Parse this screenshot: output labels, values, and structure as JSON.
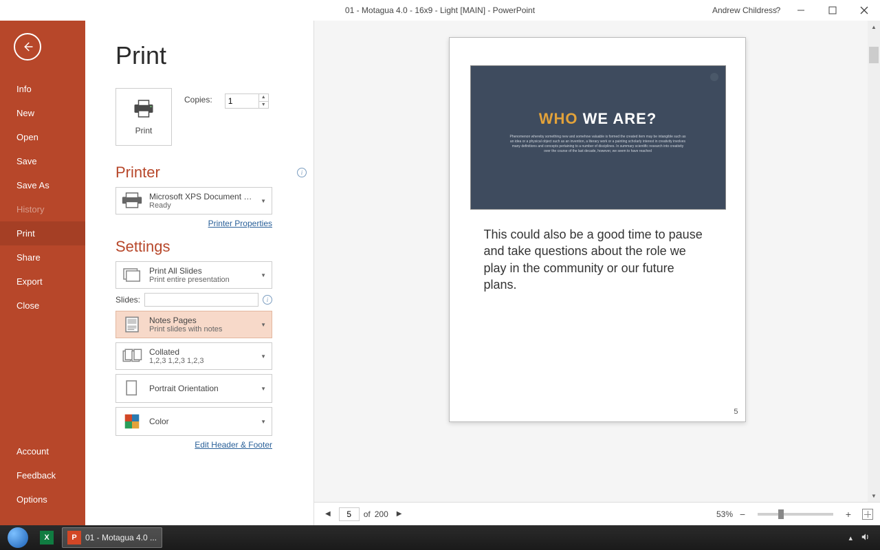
{
  "titlebar": {
    "title": "01 - Motagua 4.0 - 16x9 - Light [MAIN]  -  PowerPoint",
    "user": "Andrew Childress",
    "help": "?"
  },
  "sidebar": {
    "items": [
      {
        "label": "Info",
        "key": "info"
      },
      {
        "label": "New",
        "key": "new"
      },
      {
        "label": "Open",
        "key": "open"
      },
      {
        "label": "Save",
        "key": "save"
      },
      {
        "label": "Save As",
        "key": "saveas"
      },
      {
        "label": "History",
        "key": "history",
        "disabled": true
      },
      {
        "label": "Print",
        "key": "print",
        "selected": true
      },
      {
        "label": "Share",
        "key": "share"
      },
      {
        "label": "Export",
        "key": "export"
      },
      {
        "label": "Close",
        "key": "close"
      }
    ],
    "footer": [
      {
        "label": "Account",
        "key": "account"
      },
      {
        "label": "Feedback",
        "key": "feedback"
      },
      {
        "label": "Options",
        "key": "options"
      }
    ]
  },
  "main": {
    "title": "Print",
    "print_button": "Print",
    "copies_label": "Copies:",
    "copies_value": "1",
    "printer_heading": "Printer",
    "printer_name": "Microsoft XPS Document W...",
    "printer_status": "Ready",
    "printer_properties": "Printer Properties",
    "settings_heading": "Settings",
    "print_range_title": "Print All Slides",
    "print_range_sub": "Print entire presentation",
    "slides_label": "Slides:",
    "slides_value": "",
    "layout_title": "Notes Pages",
    "layout_sub": "Print slides with notes",
    "collate_title": "Collated",
    "collate_sub": "1,2,3    1,2,3    1,2,3",
    "orientation_title": "Portrait Orientation",
    "color_title": "Color",
    "edit_header_footer": "Edit Header & Footer"
  },
  "preview": {
    "slide_title_a": "WHO",
    "slide_title_b": " WE ARE?",
    "slide_body": "Phenomenon whereby something new and somehow valuable is formed the created item may be intangible such as an idea or a physical object such as an invention, a literary work or a painting scholarly interest in creativity involves many definitions and concepts pertaining to a number of disciplines. In summary scientific research into creativity over the course of the last decade, however, we seem to have reached",
    "notes": "This could also be a good time to pause and take questions about the role we play in the community or our future plans.",
    "page_index": "5"
  },
  "statusbar": {
    "page_current": "5",
    "page_total_prefix": " of ",
    "page_total": "200",
    "zoom": "53%"
  },
  "taskbar": {
    "app1": "01 - Motagua 4.0 ..."
  }
}
